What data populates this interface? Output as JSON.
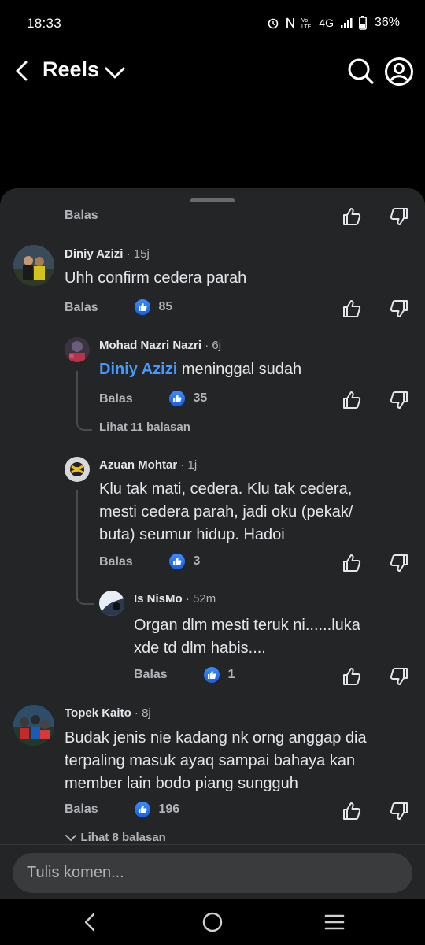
{
  "status_bar": {
    "time": "18:33",
    "network": "4G",
    "battery": "36%"
  },
  "top_bar": {
    "title": "Reels"
  },
  "colors": {
    "accent": "#1877f2",
    "mention": "#4599ff",
    "sheet_bg": "#242526"
  },
  "partial_top": {
    "reply_label": "Balas"
  },
  "comments": [
    {
      "author": "Diniy Azizi",
      "time": "15j",
      "text": "Uhh confirm cedera parah",
      "reply_label": "Balas",
      "likes": "85"
    },
    {
      "author": "Mohad Nazri Nazri",
      "time": "6j",
      "mention": "Diniy Azizi",
      "text": "meninggal sudah",
      "reply_label": "Balas",
      "likes": "35",
      "view_replies": "Lihat 11 balasan"
    },
    {
      "author": "Azuan Mohtar",
      "time": "1j",
      "text_lines": [
        "Klu tak mati, cedera. Klu tak cedera,",
        "mesti cedera parah, jadi oku (pekak/",
        "buta) seumur hidup. Hadoi"
      ],
      "reply_label": "Balas",
      "likes": "3"
    },
    {
      "author": "Is NisMo",
      "time": "52m",
      "text_lines": [
        "Organ dlm mesti teruk ni......luka",
        "xde td dlm habis...."
      ],
      "reply_label": "Balas",
      "likes": "1"
    },
    {
      "author": "Topek Kaito",
      "time": "8j",
      "text_lines": [
        "Budak jenis nie kadang nk orng anggap dia",
        "terpaling masuk ayaq sampai bahaya kan",
        "member lain bodo piang sungguh"
      ],
      "reply_label": "Balas",
      "likes": "196",
      "view_replies": "Lihat 8 balasan"
    }
  ],
  "composer": {
    "placeholder": "Tulis komen..."
  },
  "icons": [
    "back-icon",
    "chevron-down-icon",
    "search-icon",
    "profile-icon",
    "like-icon",
    "dislike-icon",
    "thumbs-up-badge-icon",
    "nav-back-icon",
    "nav-home-icon",
    "nav-recent-icon"
  ]
}
